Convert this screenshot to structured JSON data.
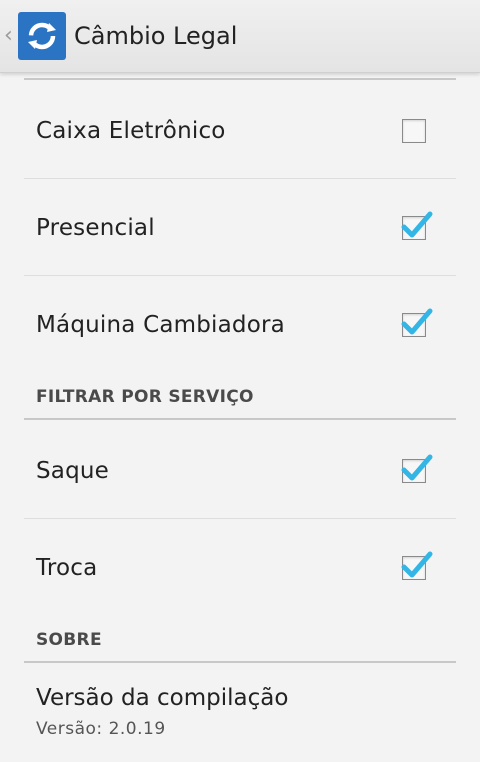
{
  "action_bar": {
    "title": "Câmbio Legal"
  },
  "preferences": {
    "type_items": [
      {
        "label": "Caixa Eletrônico",
        "checked": false
      },
      {
        "label": "Presencial",
        "checked": true
      },
      {
        "label": "Máquina Cambiadora",
        "checked": true
      }
    ],
    "service_header": "FILTRAR POR SERVIÇO",
    "service_items": [
      {
        "label": "Saque",
        "checked": true
      },
      {
        "label": "Troca",
        "checked": true
      }
    ],
    "about_header": "SOBRE",
    "about": {
      "title": "Versão da compilação",
      "summary": "Versão: 2.0.19"
    }
  },
  "colors": {
    "accent": "#33b5e5",
    "app_icon_bg": "#2b74c4"
  }
}
